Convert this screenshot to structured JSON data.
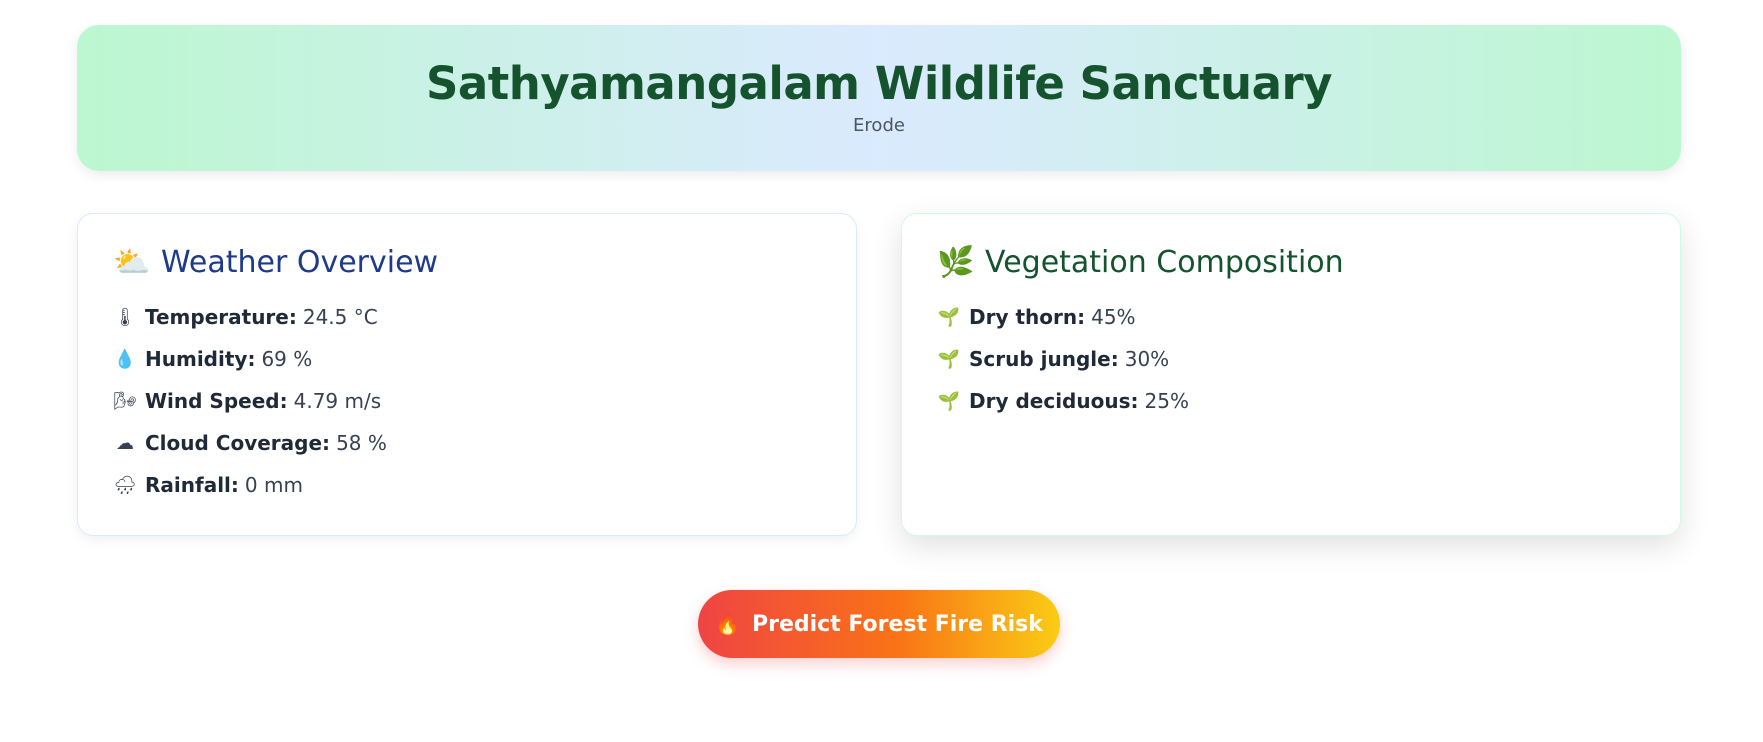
{
  "header": {
    "title": "Sathyamangalam Wildlife Sanctuary",
    "subtitle": "Erode"
  },
  "weather": {
    "icon": "sun-behind-cloud-icon",
    "title": "Weather Overview",
    "items": [
      {
        "icon": "thermometer-icon",
        "label": "Temperature:",
        "value": "24.5 °C"
      },
      {
        "icon": "droplet-icon",
        "label": "Humidity:",
        "value": "69 %"
      },
      {
        "icon": "wind-face-icon",
        "label": "Wind Speed:",
        "value": "4.79 m/s"
      },
      {
        "icon": "cloud-icon",
        "label": "Cloud Coverage:",
        "value": "58 %"
      },
      {
        "icon": "rain-cloud-icon",
        "label": "Rainfall:",
        "value": "0 mm"
      }
    ]
  },
  "vegetation": {
    "icon": "herb-icon",
    "title": "Vegetation Composition",
    "items": [
      {
        "icon": "seedling-icon",
        "label": "Dry thorn:",
        "value": "45%"
      },
      {
        "icon": "seedling-icon",
        "label": "Scrub jungle:",
        "value": "30%"
      },
      {
        "icon": "seedling-icon",
        "label": "Dry deciduous:",
        "value": "25%"
      }
    ]
  },
  "action": {
    "icon": "fire-icon",
    "label": "Predict Forest Fire Risk"
  },
  "colors": {
    "header_title": "#14532d",
    "weather_title": "#1e3a8a",
    "vegetation_title": "#14532d",
    "button_gradient_start": "#ef4444",
    "button_gradient_end": "#facc15"
  }
}
